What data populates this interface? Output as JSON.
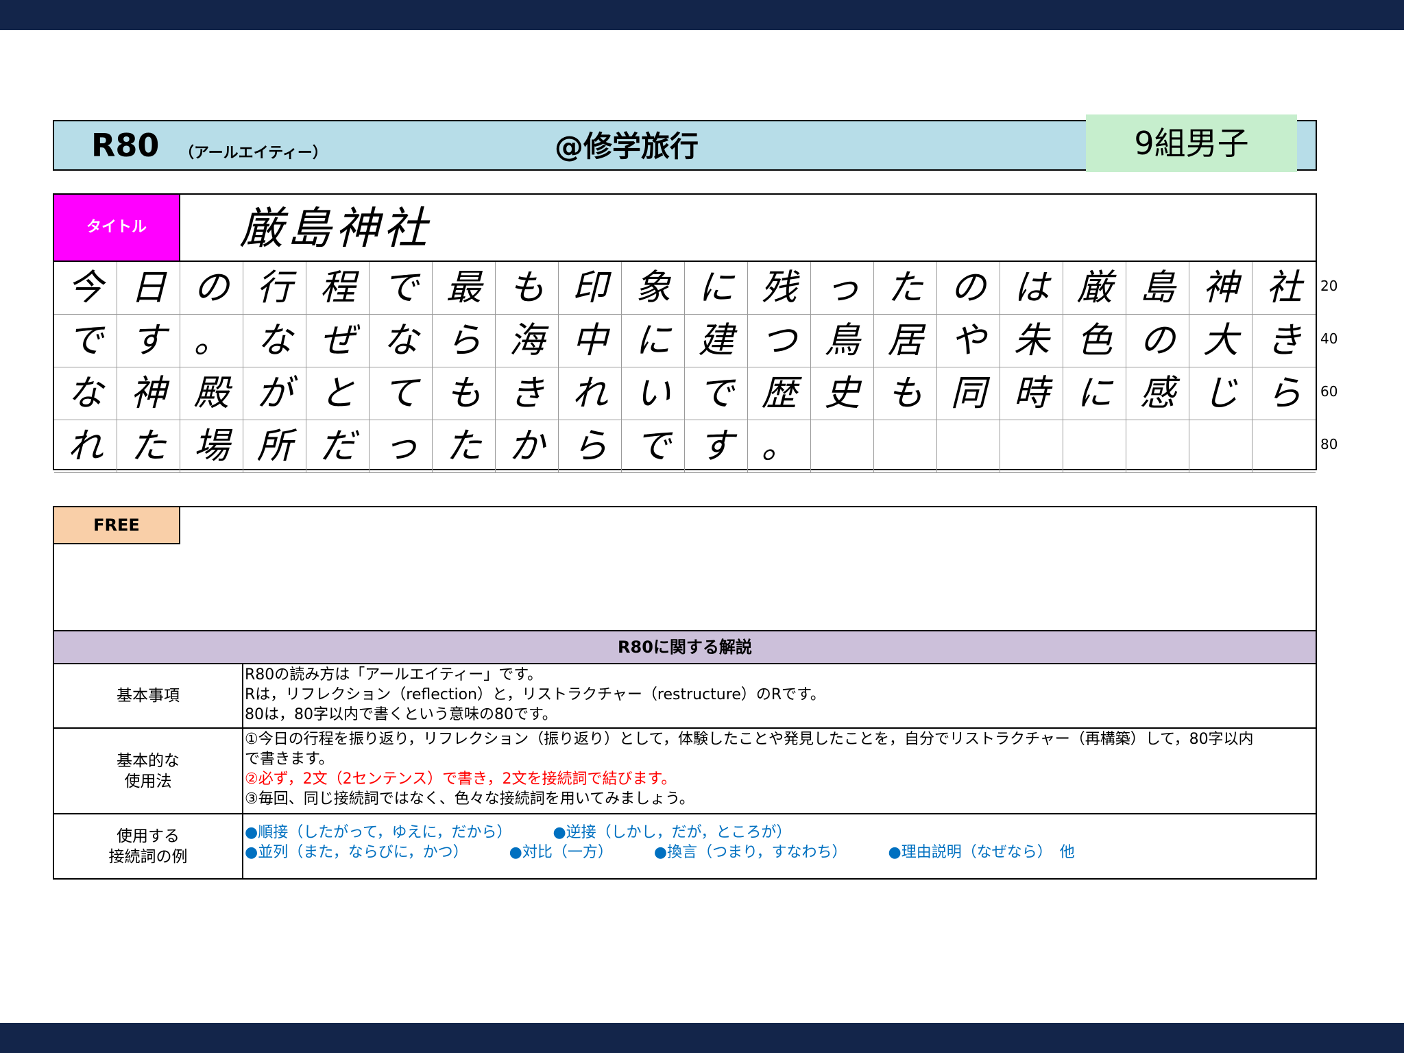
{
  "header": {
    "r80": "R80",
    "r80_reading": "（アールエイティー）",
    "subject": "@修学旅行",
    "group": "9組男子"
  },
  "title_row": {
    "label": "タイトル",
    "value": "厳島神社"
  },
  "grid": {
    "rows": [
      [
        "今",
        "日",
        "の",
        "行",
        "程",
        "で",
        "最",
        "も",
        "印",
        "象",
        "に",
        "残",
        "っ",
        "た",
        "の",
        "は",
        "厳",
        "島",
        "神",
        "社"
      ],
      [
        "で",
        "す",
        "。",
        "な",
        "ぜ",
        "な",
        "ら",
        "海",
        "中",
        "に",
        "建",
        "つ",
        "鳥",
        "居",
        "や",
        "朱",
        "色",
        "の",
        "大",
        "き"
      ],
      [
        "な",
        "神",
        "殿",
        "が",
        "と",
        "て",
        "も",
        "き",
        "れ",
        "い",
        "で",
        "歴",
        "史",
        "も",
        "同",
        "時",
        "に",
        "感",
        "じ",
        "ら"
      ],
      [
        "れ",
        "た",
        "場",
        "所",
        "だ",
        "っ",
        "た",
        "か",
        "ら",
        "で",
        "す",
        "。",
        "",
        "",
        "",
        "",
        "",
        "",
        "",
        ""
      ]
    ],
    "counters": [
      "20",
      "40",
      "60",
      "80"
    ]
  },
  "free": {
    "label": "FREE"
  },
  "explanation": {
    "heading": "R80に関する解説",
    "basics": {
      "label_lines": [
        "基本事項"
      ],
      "lines": [
        "R80の読み方は「アールエイティー」です。",
        "Rは，リフレクション（reflection）と，リストラクチャー（restructure）のRです。",
        "80は，80字以内で書くという意味の80です。"
      ]
    },
    "usage": {
      "label_lines": [
        "基本的な",
        "使用法"
      ],
      "line1": "①今日の行程を振り返り，リフレクション（振り返り）として，体験したことや発見したことを，自分でリストラクチャー（再構築）して，80字以内",
      "line2": "で書きます。",
      "line3_red": "②必ず，2文（2センテンス）で書き，2文を接続詞で結びます。",
      "line4": "③毎回、同じ接続詞ではなく、色々な接続詞を用いてみましょう。"
    },
    "conjunctions": {
      "label_lines": [
        "使用する",
        "接続詞の例"
      ],
      "row1": [
        "●順接（したがって，ゆえに，だから）",
        "●逆接（しかし，だが，ところが）"
      ],
      "row2": [
        "●並列（また，ならびに，かつ）",
        "●対比（一方）",
        "●換言（つまり，すなわち）",
        "●理由説明（なぜなら）　他"
      ],
      "color": "#0070c0"
    }
  },
  "colors": {
    "navy_bar": "#13254a",
    "header_bg": "#b7dde8",
    "group_bg": "#c6eecd",
    "title_label_bg": "#ff00ff",
    "free_label_bg": "#f9cfa8",
    "explain_head_bg": "#ccc0da",
    "emphasis_red": "#ff0000"
  }
}
